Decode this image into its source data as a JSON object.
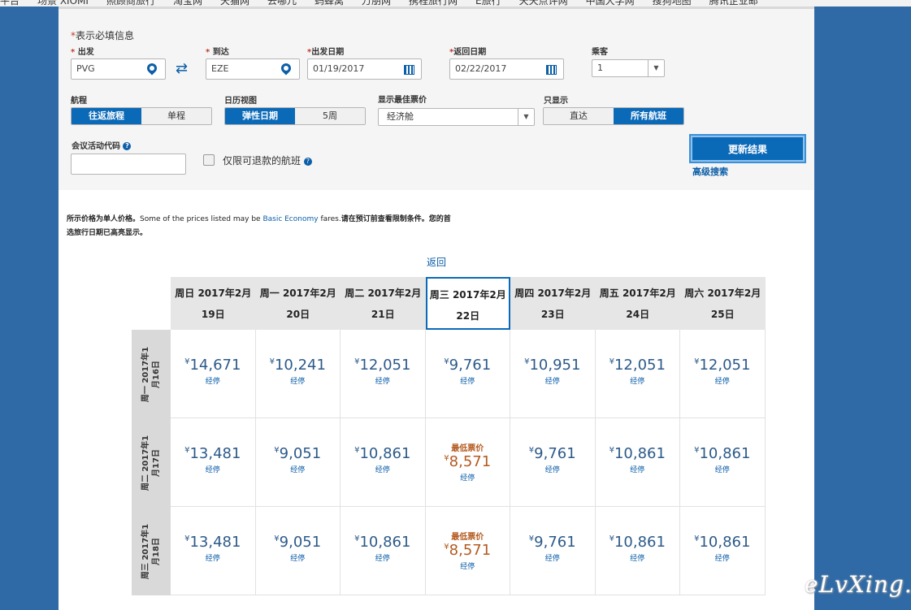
{
  "bookmarks": [
    "平台",
    "场景 XIOMI",
    "照顾商旅行",
    "淘宝网",
    "天猫网",
    "去哪儿",
    "蚂蜂窝",
    "万朋网",
    "携程旅行网",
    "E旅行",
    "天天点评网",
    "中国大学网",
    "搜狗地图",
    "腾讯企业邮"
  ],
  "form": {
    "required_note": "表示必填信息",
    "required_star": "*",
    "origin": {
      "label": "出发",
      "value": "PVG"
    },
    "destination": {
      "label": "到达",
      "value": "EZE"
    },
    "depart_date": {
      "label": "出发日期",
      "value": "01/19/2017"
    },
    "return_date": {
      "label": "返回日期",
      "value": "02/22/2017"
    },
    "passengers": {
      "label": "乘客",
      "value": "1"
    },
    "swap_icon": "⇄",
    "trip_type": {
      "label": "航程",
      "options": [
        "往返旅程",
        "单程"
      ],
      "selected": "往返旅程"
    },
    "calendar_range": {
      "label": "日历视图",
      "options": [
        "弹性日期",
        "5周"
      ],
      "selected": "弹性日期"
    },
    "cabin": {
      "label": "显示最佳票价",
      "value": "经济舱"
    },
    "show_only": {
      "label": "只显示",
      "options": [
        "直达",
        "所有航班"
      ],
      "selected": "所有航班"
    },
    "promo": {
      "label": "会议活动代码",
      "value": ""
    },
    "refundable_label": "仅限可退款的航班",
    "help_glyph": "?",
    "update_button": "更新结果",
    "advanced_link": "高级搜索"
  },
  "info": {
    "part1": "所示价格为单人价格。",
    "part2": "Some of the prices listed may be ",
    "link": "Basic Economy",
    "part3": " fares.",
    "part4": "请在预订前查看限制条件。您的首选旅行日期已高亮显示。"
  },
  "calendar": {
    "return_label": "返回",
    "columns": [
      {
        "line1": "周日 2017年2月",
        "line2": "19日"
      },
      {
        "line1": "周一 2017年2月",
        "line2": "20日"
      },
      {
        "line1": "周二 2017年2月",
        "line2": "21日"
      },
      {
        "line1": "周三 2017年2月",
        "line2": "22日"
      },
      {
        "line1": "周四 2017年2月",
        "line2": "23日"
      },
      {
        "line1": "周五 2017年2月",
        "line2": "24日"
      },
      {
        "line1": "周六 2017年2月",
        "line2": "25日"
      }
    ],
    "selected_column": 3,
    "currency": "¥",
    "stops_label": "经停",
    "lowest_label": "最低票价",
    "rows": [
      {
        "line1": "周一 2017年1",
        "line2": "月16日",
        "prices": [
          "14,671",
          "10,241",
          "12,051",
          "9,761",
          "10,951",
          "12,051",
          "12,051"
        ],
        "lowest": []
      },
      {
        "line1": "周二 2017年1",
        "line2": "月17日",
        "prices": [
          "13,481",
          "9,051",
          "10,861",
          "8,571",
          "9,761",
          "10,861",
          "10,861"
        ],
        "lowest": [
          3
        ]
      },
      {
        "line1": "周三 2017年1",
        "line2": "月18日",
        "prices": [
          "13,481",
          "9,051",
          "10,861",
          "8,571",
          "9,761",
          "10,861",
          "10,861"
        ],
        "lowest": [
          3
        ]
      }
    ]
  },
  "watermark": "eLvXing.net"
}
